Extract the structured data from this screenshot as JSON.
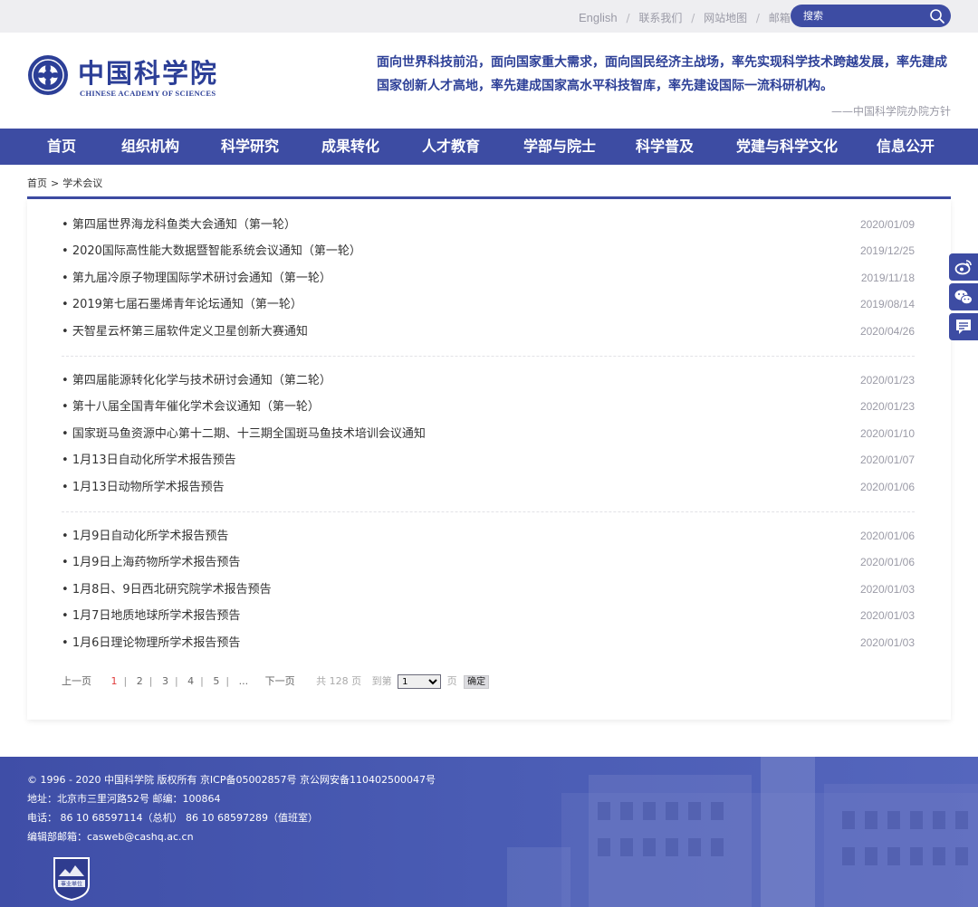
{
  "topbar": {
    "links": [
      "English",
      "联系我们",
      "网站地图",
      "邮箱"
    ],
    "search_placeholder": "搜索"
  },
  "header": {
    "logo_cn": "中国科学院",
    "logo_en": "CHINESE ACADEMY OF SCIENCES",
    "motto_line1": "面向世界科技前沿，面向国家重大需求，面向国民经济主战场，率先实现科学技术跨越发展，率先建成",
    "motto_line2": "国家创新人才高地，率先建成国家高水平科技智库，率先建设国际一流科研机构。",
    "motto_source": "——中国科学院办院方针"
  },
  "nav": {
    "items": [
      "首页",
      "组织机构",
      "科学研究",
      "成果转化",
      "人才教育",
      "学部与院士",
      "科学普及",
      "党建与科学文化",
      "信息公开"
    ]
  },
  "breadcrumb": {
    "home": "首页",
    "sep": ">",
    "current": "学术会议"
  },
  "groups": [
    [
      {
        "title": "第四届世界海龙科鱼类大会通知（第一轮）",
        "date": "2020/01/09"
      },
      {
        "title": "2020国际高性能大数据暨智能系统会议通知（第一轮）",
        "date": "2019/12/25"
      },
      {
        "title": "第九届冷原子物理国际学术研讨会通知（第一轮）",
        "date": "2019/11/18"
      },
      {
        "title": "2019第七届石墨烯青年论坛通知（第一轮）",
        "date": "2019/08/14"
      },
      {
        "title": "天智星云杯第三届软件定义卫星创新大赛通知",
        "date": "2020/04/26"
      }
    ],
    [
      {
        "title": "第四届能源转化化学与技术研讨会通知（第二轮）",
        "date": "2020/01/23"
      },
      {
        "title": "第十八届全国青年催化学术会议通知（第一轮）",
        "date": "2020/01/23"
      },
      {
        "title": "国家斑马鱼资源中心第十二期、十三期全国斑马鱼技术培训会议通知",
        "date": "2020/01/10"
      },
      {
        "title": "1月13日自动化所学术报告预告",
        "date": "2020/01/07"
      },
      {
        "title": "1月13日动物所学术报告预告",
        "date": "2020/01/06"
      }
    ],
    [
      {
        "title": "1月9日自动化所学术报告预告",
        "date": "2020/01/06"
      },
      {
        "title": "1月9日上海药物所学术报告预告",
        "date": "2020/01/06"
      },
      {
        "title": "1月8日、9日西北研究院学术报告预告",
        "date": "2020/01/03"
      },
      {
        "title": "1月7日地质地球所学术报告预告",
        "date": "2020/01/03"
      },
      {
        "title": "1月6日理论物理所学术报告预告",
        "date": "2020/01/03"
      }
    ]
  ],
  "pager": {
    "prev": "上一页",
    "pages": [
      "1",
      "2",
      "3",
      "4",
      "5",
      "..."
    ],
    "current": "1",
    "next": "下一页",
    "total": "共 128 页",
    "goto": "到第",
    "goto_value": "1",
    "page_unit": "页",
    "confirm": "确定"
  },
  "footer": {
    "copyright": "© 1996 - 2020 中国科学院 版权所有   京ICP备05002857号   京公网安备110402500047号",
    "address": "地址：北京市三里河路52号 邮编：100864",
    "phone": "电话： 86 10 68597114（总机）   86 10 68597289（值班室）",
    "email": "编辑部邮箱：casweb@cashq.ac.cn",
    "badge_label": "事业单位"
  },
  "colors": {
    "brand": "#3d4ca3",
    "accent_red": "#e03a3a"
  }
}
